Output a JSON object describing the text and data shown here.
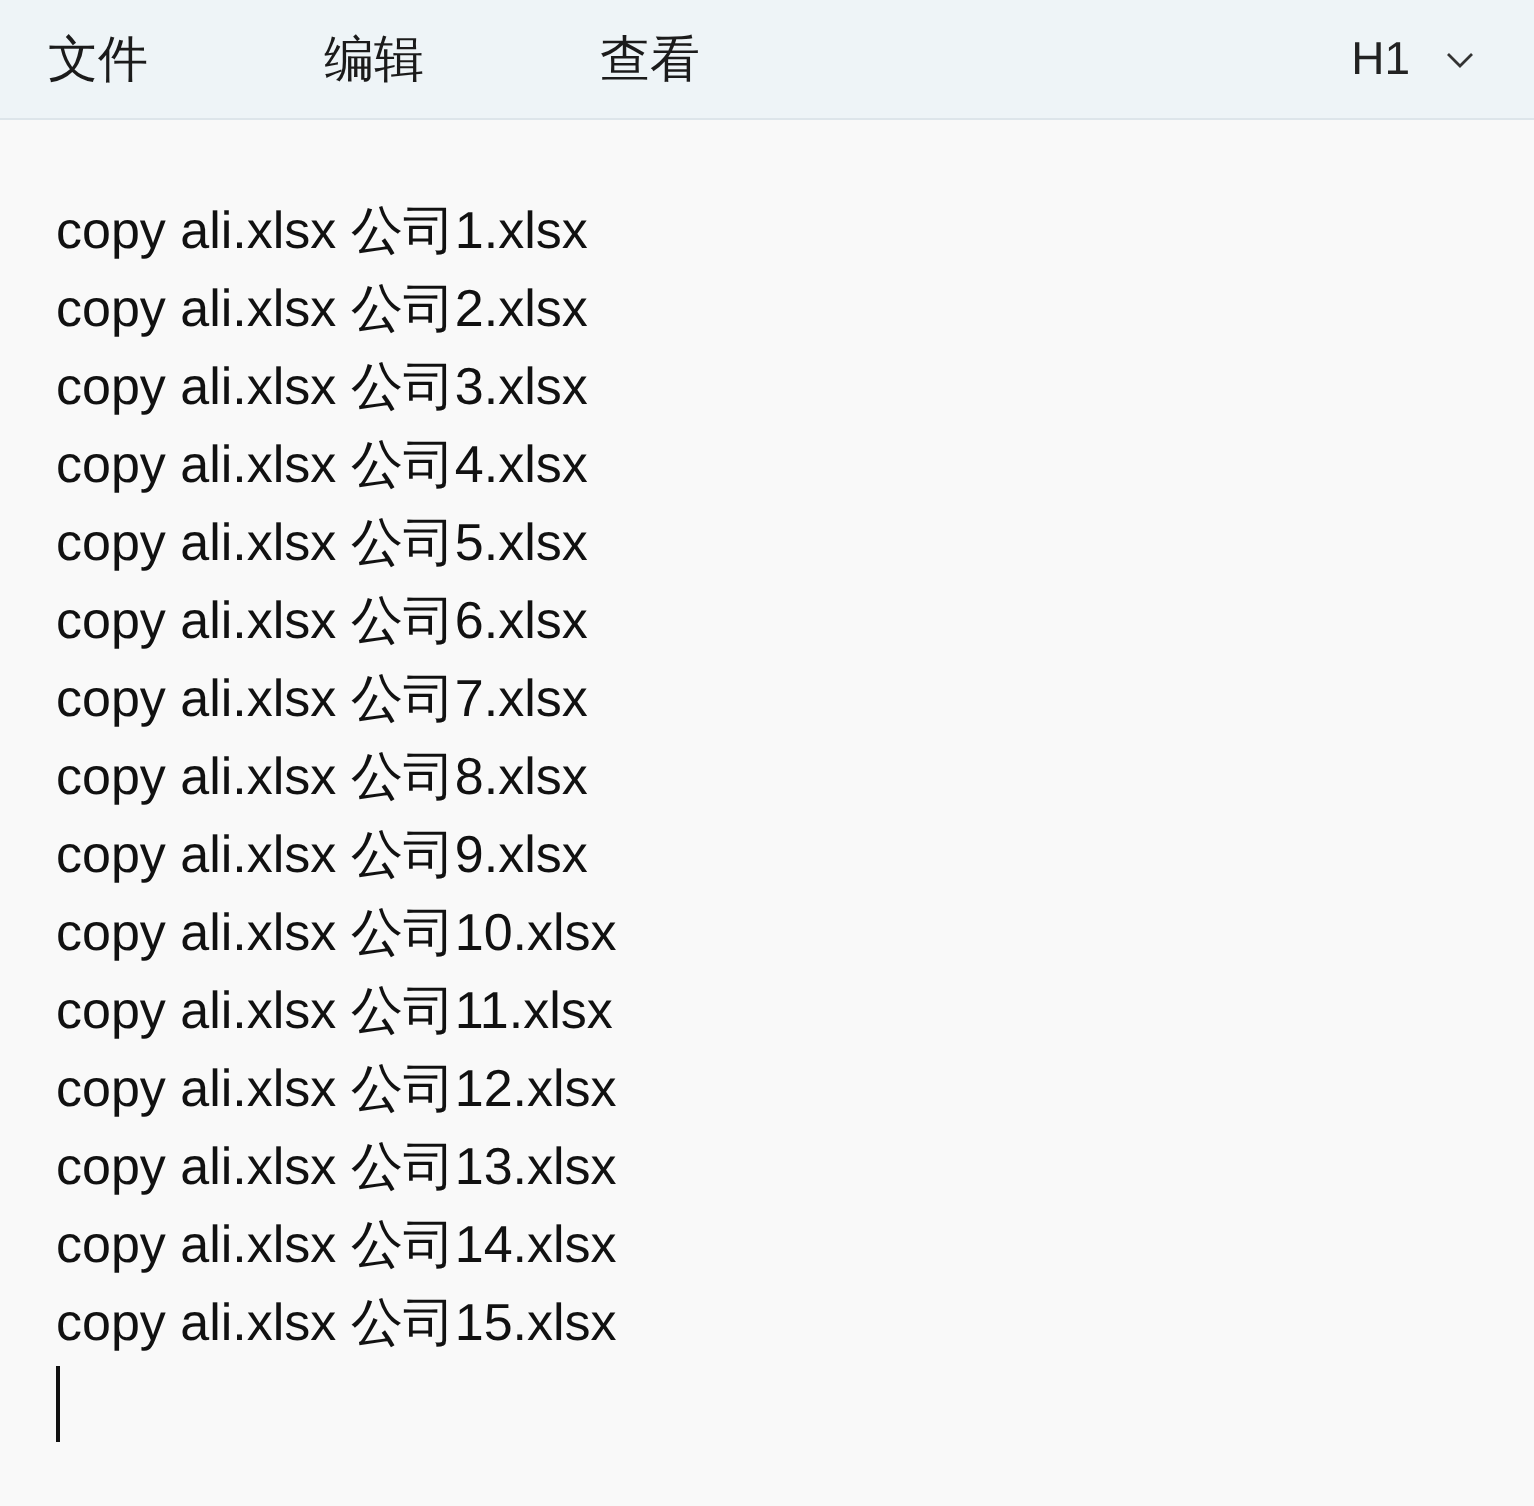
{
  "menu_bar": {
    "items": [
      "文件",
      "编辑",
      "查看"
    ],
    "heading_dropdown": {
      "value": "H1"
    }
  },
  "editor": {
    "lines": [
      "copy ali.xlsx 公司1.xlsx",
      "copy ali.xlsx 公司2.xlsx",
      "copy ali.xlsx 公司3.xlsx",
      "copy ali.xlsx 公司4.xlsx",
      "copy ali.xlsx 公司5.xlsx",
      "copy ali.xlsx 公司6.xlsx",
      "copy ali.xlsx 公司7.xlsx",
      "copy ali.xlsx 公司8.xlsx",
      "copy ali.xlsx 公司9.xlsx",
      "copy ali.xlsx 公司10.xlsx",
      "copy ali.xlsx 公司11.xlsx",
      "copy ali.xlsx 公司12.xlsx",
      "copy ali.xlsx 公司13.xlsx",
      "copy ali.xlsx 公司14.xlsx",
      "copy ali.xlsx 公司15.xlsx"
    ]
  }
}
